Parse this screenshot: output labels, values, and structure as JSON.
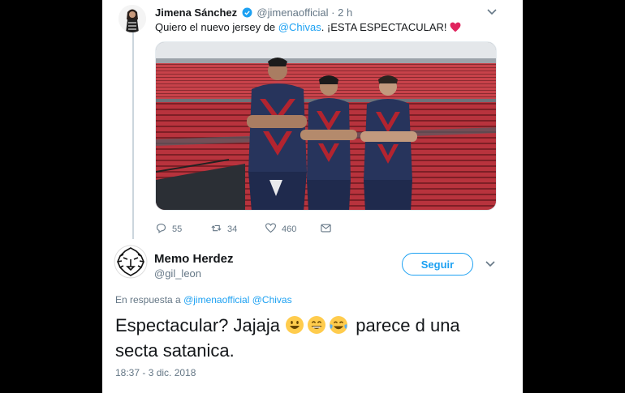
{
  "tweet": {
    "author_name": "Jimena Sánchez",
    "handle": "@jimenaofficial",
    "separator": "·",
    "time": "2 h",
    "text_prefix": "Quiero el nuevo jersey de ",
    "mention": "@Chivas",
    "text_suffix": ". ¡ESTA ESPECTACULAR! ",
    "actions": {
      "replies": "55",
      "retweets": "34",
      "likes": "460"
    }
  },
  "reply": {
    "author_name": "Memo Herdez",
    "handle": "@gil_leon",
    "follow_label": "Seguir",
    "in_reply_prefix": "En respuesta a ",
    "in_reply_mentions": "@jimenaofficial @Chivas",
    "text_part1": "Espectacular? Jajaja ",
    "text_part2": " parece d una secta satanica.",
    "timestamp": "18:37 - 3 dic. 2018"
  },
  "colors": {
    "accent": "#1da1f2",
    "muted": "#657786",
    "heart": "#e0245e"
  }
}
